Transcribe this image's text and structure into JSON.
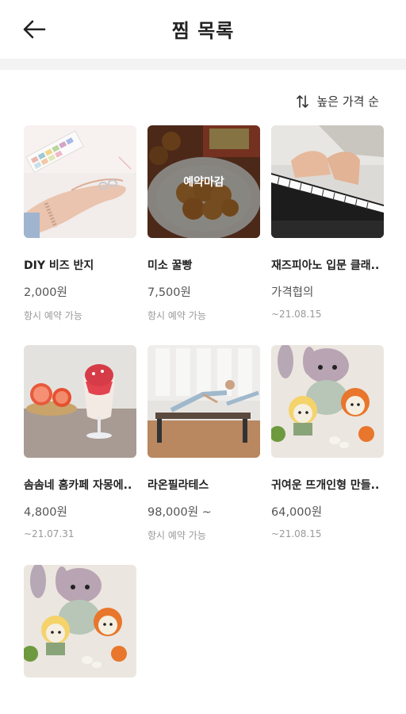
{
  "header": {
    "title": "찜 목록",
    "back_icon": "arrow-left-icon"
  },
  "sort": {
    "label": "높은 가격 순",
    "icon": "sort-updown-icon"
  },
  "items": [
    {
      "name": "DIY 비즈 반지",
      "price": "2,000원",
      "sub": "항시 예약 가능",
      "overlay": ""
    },
    {
      "name": "미소 꿀빵",
      "price": "7,500원",
      "sub": "항시 예약 가능",
      "overlay": "예약마감"
    },
    {
      "name": "재즈피아노 입문 클래..",
      "price": "가격협의",
      "sub": "~21.08.15",
      "overlay": ""
    },
    {
      "name": "솜솜네 홈카페 자몽에..",
      "price": "4,800원",
      "sub": "~21.07.31",
      "overlay": ""
    },
    {
      "name": "라온필라테스",
      "price": "98,000원 ~",
      "sub": "항시 예약 가능",
      "overlay": ""
    },
    {
      "name": "귀여운 뜨개인형 만들..",
      "price": "64,000원",
      "sub": "~21.08.15",
      "overlay": ""
    },
    {
      "name": "",
      "price": "",
      "sub": "",
      "overlay": ""
    }
  ]
}
